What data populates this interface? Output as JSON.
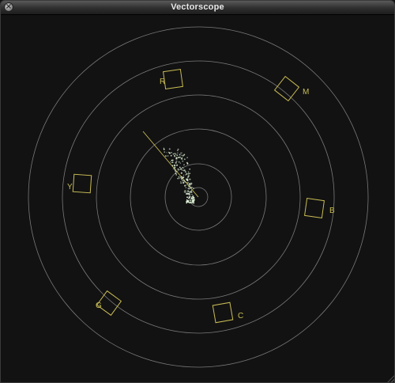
{
  "window": {
    "title": "Vectorscope"
  },
  "icons": {
    "close": "close-icon"
  },
  "colors": {
    "graticule": "#7a7a7a",
    "target": "#c9bd55",
    "trace": "#dcefd4",
    "background": "#121212"
  },
  "targets": [
    {
      "label": "R"
    },
    {
      "label": "M"
    },
    {
      "label": "B"
    },
    {
      "label": "C"
    },
    {
      "label": "G"
    },
    {
      "label": "Y"
    }
  ]
}
